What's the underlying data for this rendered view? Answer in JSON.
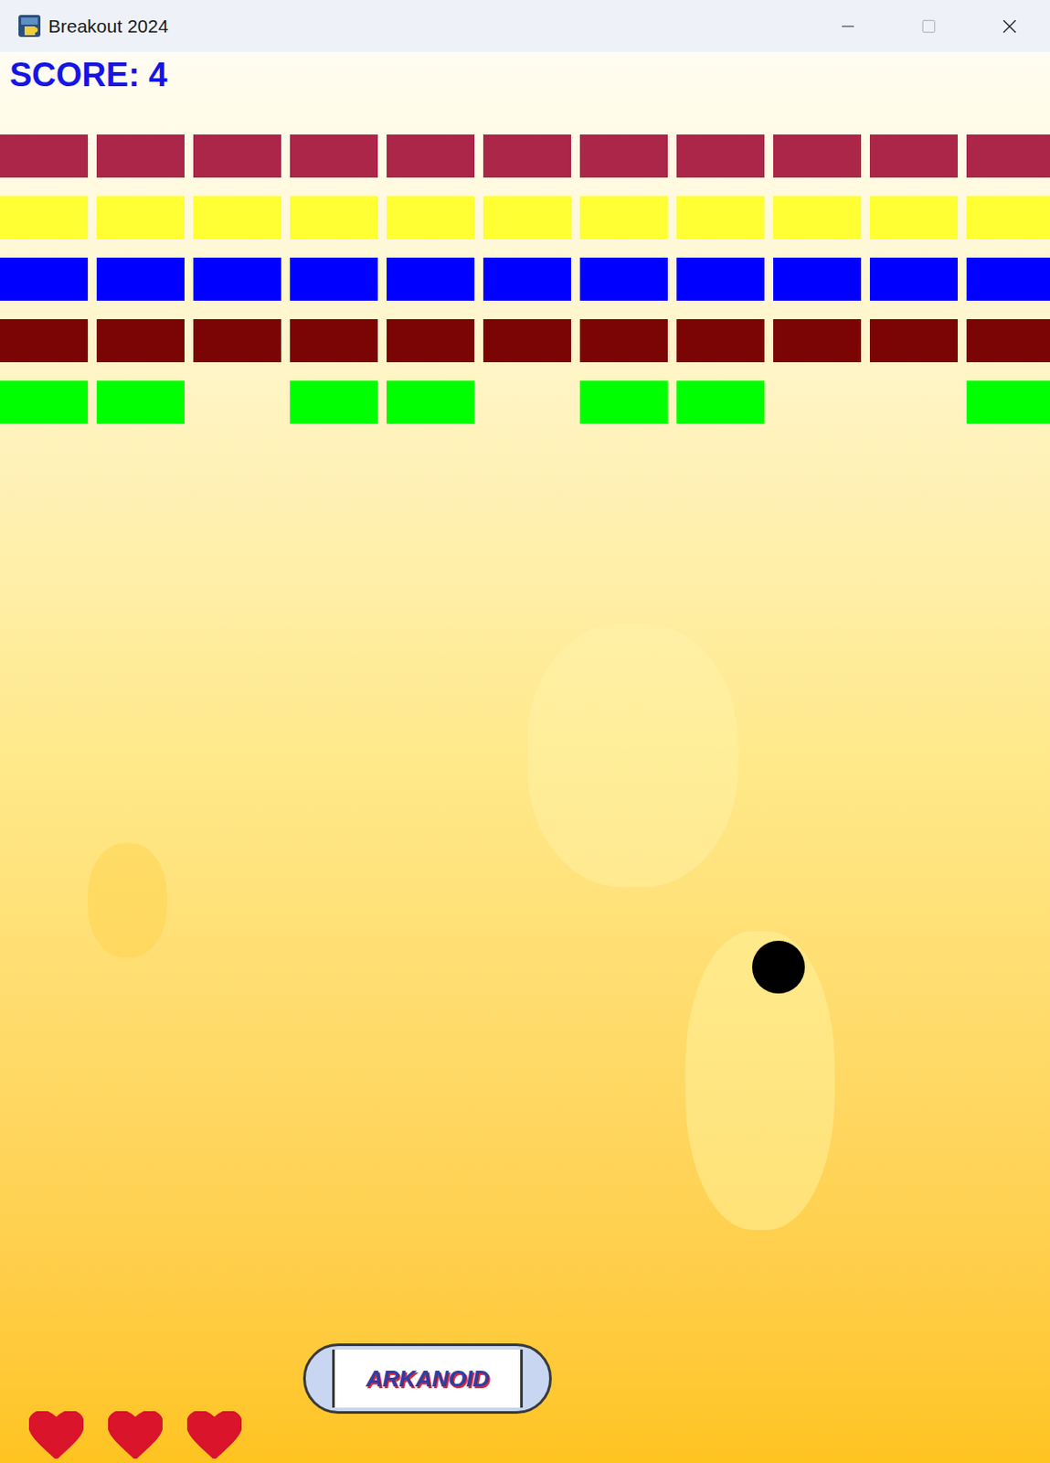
{
  "window": {
    "title": "Breakout 2024"
  },
  "score": {
    "label": "SCORE: 4"
  },
  "bricks": [
    {
      "color": "#ab2649",
      "cells": [
        true,
        true,
        true,
        true,
        true,
        true,
        true,
        true,
        true,
        true,
        true
      ]
    },
    {
      "color": "#ffff33",
      "cells": [
        true,
        true,
        true,
        true,
        true,
        true,
        true,
        true,
        true,
        true,
        true
      ]
    },
    {
      "color": "#0000ff",
      "cells": [
        true,
        true,
        true,
        true,
        true,
        true,
        true,
        true,
        true,
        true,
        true
      ]
    },
    {
      "color": "#7b0505",
      "cells": [
        true,
        true,
        true,
        true,
        true,
        true,
        true,
        true,
        true,
        true,
        true
      ]
    },
    {
      "color": "#00ff00",
      "cells": [
        true,
        true,
        false,
        true,
        true,
        false,
        true,
        true,
        false,
        false,
        true
      ]
    }
  ],
  "paddle": {
    "label": "ARKANOID"
  },
  "lives": [
    {
      "full": true
    },
    {
      "full": true
    },
    {
      "full": true
    }
  ]
}
